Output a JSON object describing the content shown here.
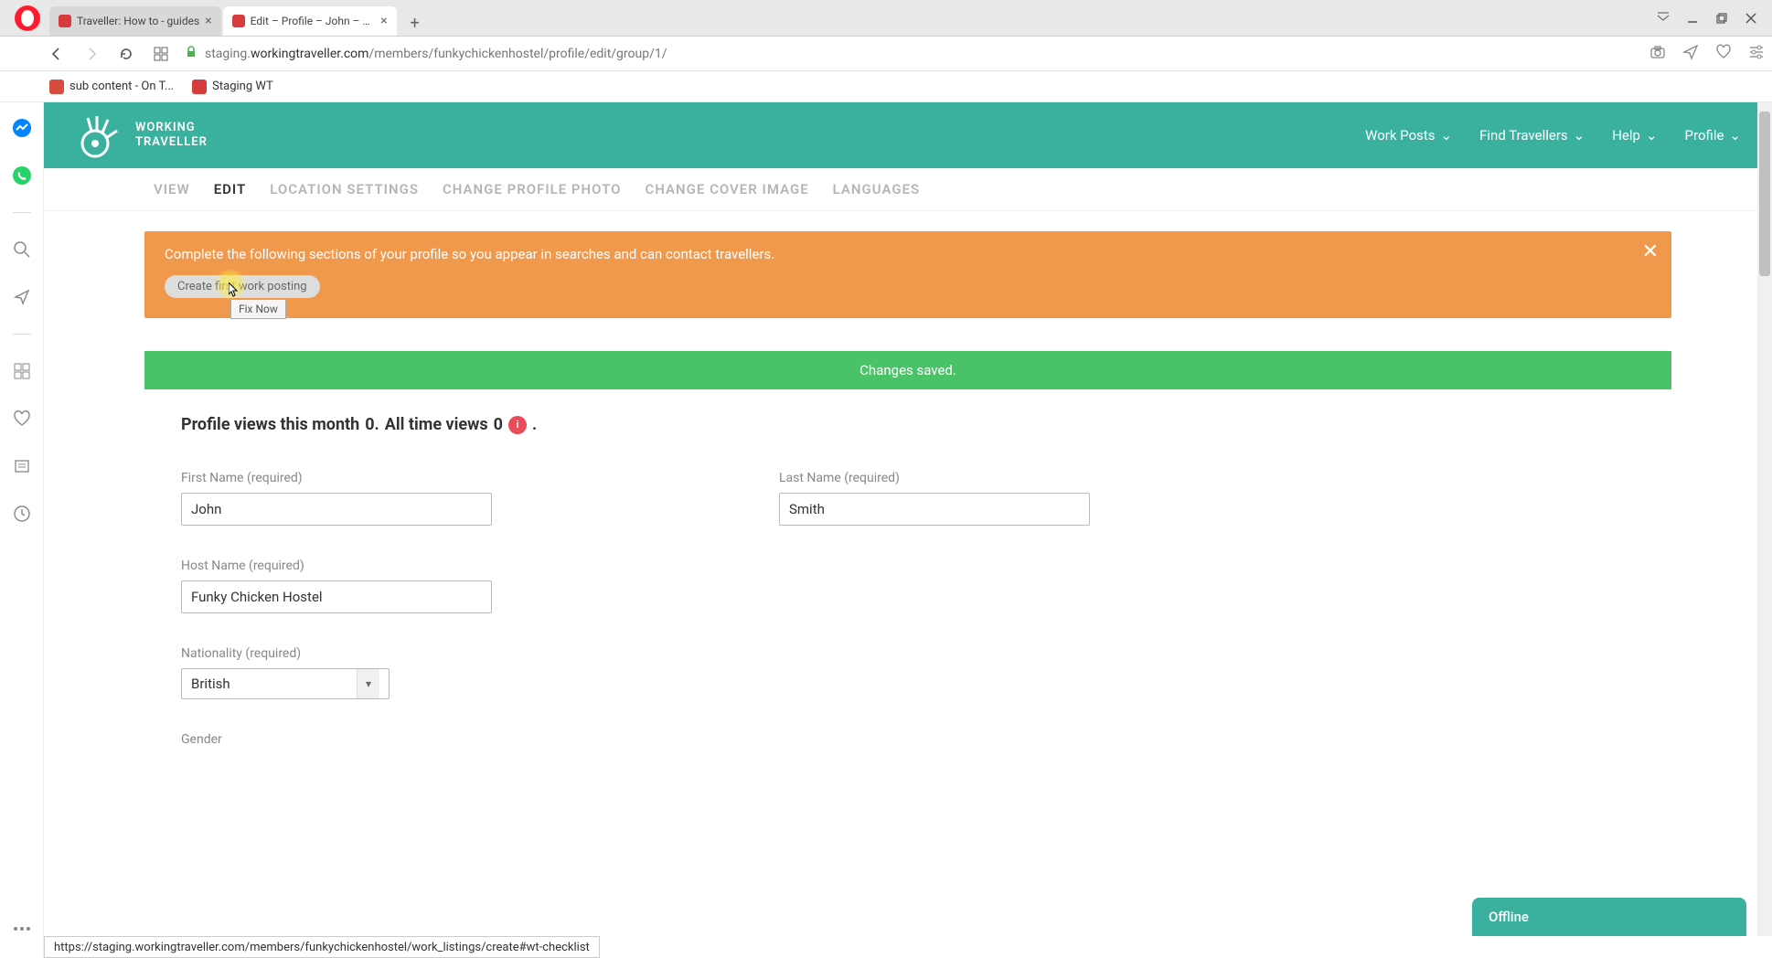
{
  "browser": {
    "tabs": [
      {
        "title": "Traveller: How to - guides"
      },
      {
        "title": "Edit – Profile – John – Work"
      }
    ],
    "url_prefix": "staging.",
    "url_domain": "workingtraveller.com",
    "url_path": "/members/funkychickenhostel/profile/edit/group/1/",
    "bookmarks": [
      {
        "label": "sub content - On T..."
      },
      {
        "label": "Staging WT"
      }
    ]
  },
  "header": {
    "logo_line1": "WORKING",
    "logo_line2": "TRAVELLER",
    "nav": [
      {
        "label": "Work Posts"
      },
      {
        "label": "Find Travellers"
      },
      {
        "label": "Help"
      },
      {
        "label": "Profile"
      }
    ]
  },
  "profile_tabs": [
    {
      "label": "VIEW"
    },
    {
      "label": "EDIT",
      "active": true
    },
    {
      "label": "LOCATION SETTINGS"
    },
    {
      "label": "CHANGE PROFILE PHOTO"
    },
    {
      "label": "CHANGE COVER IMAGE"
    },
    {
      "label": "LANGUAGES"
    }
  ],
  "alert": {
    "message": "Complete the following sections of your profile so you appear in searches and can contact travellers.",
    "button": "Create first work posting",
    "tooltip": "Fix Now"
  },
  "success": {
    "message": "Changes saved."
  },
  "stats": {
    "text_month": "Profile views this month",
    "month_val": "0.",
    "text_all": "All time views",
    "all_val": "0",
    "info": "i",
    "suffix": "."
  },
  "form": {
    "first_name": {
      "label": "First Name (required)",
      "value": "John"
    },
    "last_name": {
      "label": "Last Name (required)",
      "value": "Smith"
    },
    "host_name": {
      "label": "Host Name (required)",
      "value": "Funky Chicken Hostel"
    },
    "nationality": {
      "label": "Nationality (required)",
      "value": "British"
    },
    "gender": {
      "label": "Gender"
    }
  },
  "chat": {
    "label": "Offline"
  },
  "status_url": "https://staging.workingtraveller.com/members/funkychickenhostel/work_listings/create#wt-checklist"
}
